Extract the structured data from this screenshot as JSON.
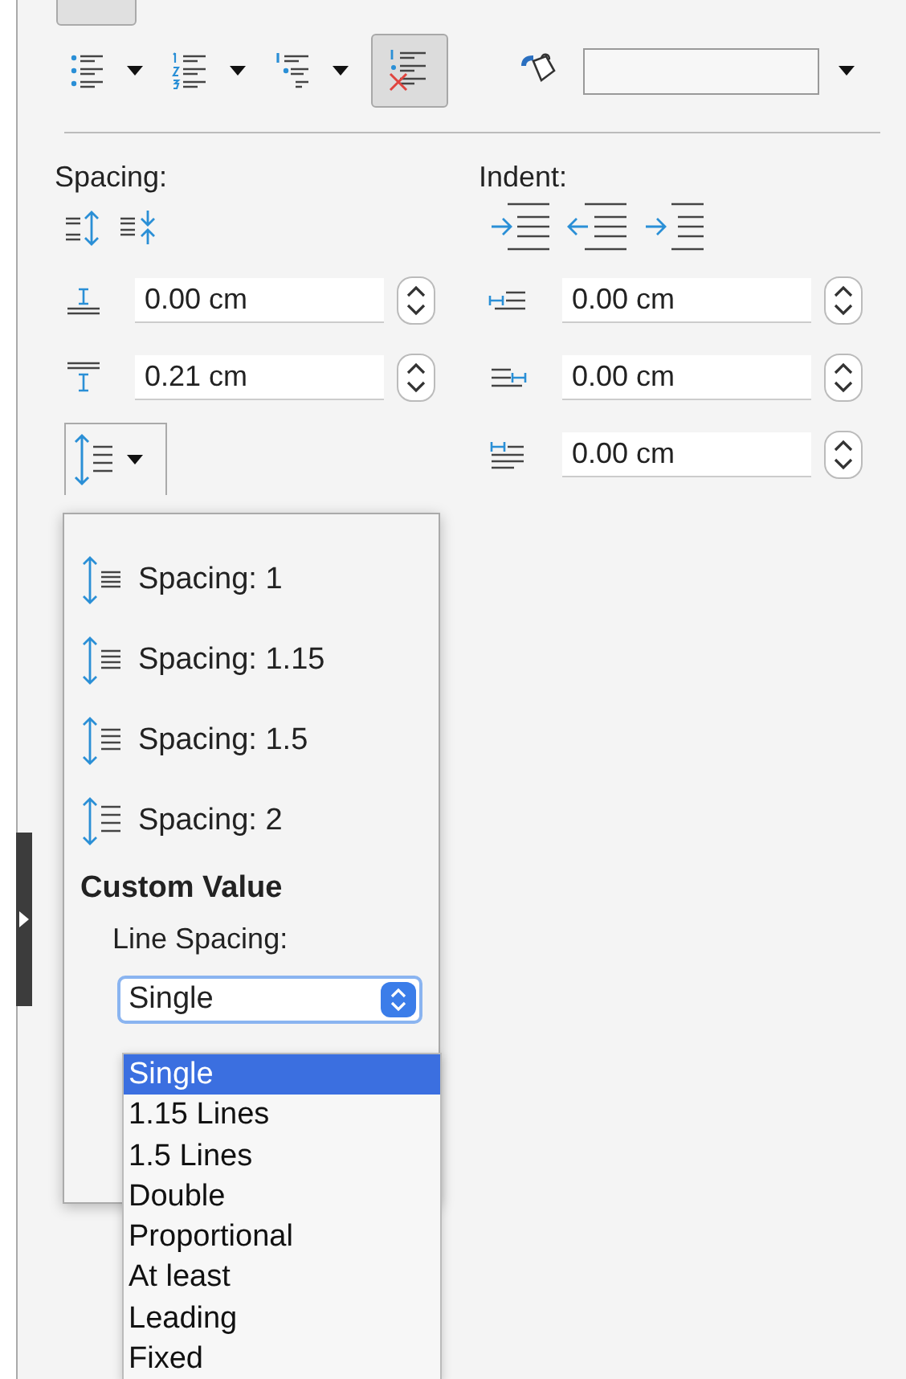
{
  "list_buttons": [
    {
      "kind": "bullets",
      "selected": false
    },
    {
      "kind": "numbers",
      "selected": false
    },
    {
      "kind": "outline",
      "selected": false
    },
    {
      "kind": "nolist",
      "selected": true
    }
  ],
  "spacing": {
    "label": "Spacing:",
    "fields": [
      {
        "kind": "above",
        "value": "0.00 cm"
      },
      {
        "kind": "below",
        "value": "0.21 cm"
      }
    ]
  },
  "indent": {
    "label": "Indent:",
    "fields": [
      {
        "kind": "before",
        "value": "0.00 cm"
      },
      {
        "kind": "after",
        "value": "0.00 cm"
      },
      {
        "kind": "first",
        "value": "0.00 cm"
      }
    ]
  },
  "line_spacing_menu": {
    "items": [
      {
        "label": "Spacing: 1",
        "kind": "s1"
      },
      {
        "label": "Spacing: 1.15",
        "kind": "s115"
      },
      {
        "label": "Spacing: 1.5",
        "kind": "s15"
      },
      {
        "label": "Spacing: 2",
        "kind": "s2"
      }
    ],
    "custom_heading": "Custom Value",
    "line_spacing_label": "Line Spacing:",
    "select_value": "Single",
    "options": [
      {
        "label": "Single",
        "selected": true
      },
      {
        "label": "1.15 Lines",
        "selected": false
      },
      {
        "label": "1.5 Lines",
        "selected": false
      },
      {
        "label": "Double",
        "selected": false
      },
      {
        "label": "Proportional",
        "selected": false
      },
      {
        "label": "At least",
        "selected": false
      },
      {
        "label": "Leading",
        "selected": false
      },
      {
        "label": "Fixed",
        "selected": false
      }
    ]
  }
}
